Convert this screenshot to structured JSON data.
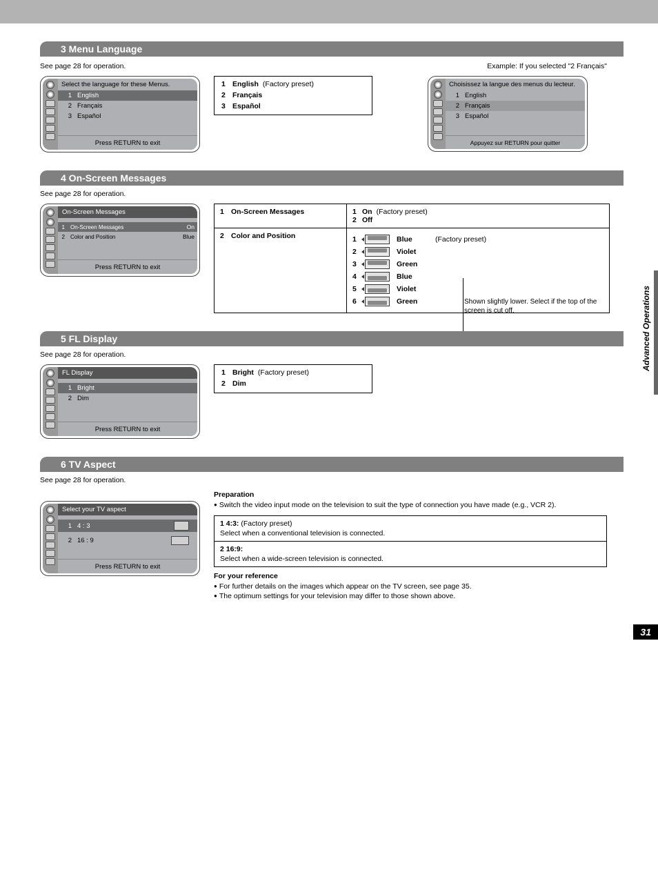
{
  "sideTab": "Advanced Operations",
  "pageNumber": "31",
  "section3": {
    "header": "3  Menu Language",
    "note": "See page 28 for operation.",
    "exampleLabel": "Example:  If you selected \"2 Français\"",
    "menu": {
      "title": "Select the language for these Menus.",
      "items": [
        {
          "num": "1",
          "label": "English"
        },
        {
          "num": "2",
          "label": "Français"
        },
        {
          "num": "3",
          "label": "Español"
        }
      ],
      "footer": "Press RETURN to exit"
    },
    "options": [
      {
        "num": "1",
        "label": "English",
        "note": " (Factory preset)"
      },
      {
        "num": "2",
        "label": "Français",
        "note": ""
      },
      {
        "num": "3",
        "label": "Español",
        "note": ""
      }
    ],
    "menuFr": {
      "title": "Choisissez la langue des menus du lecteur.",
      "items": [
        {
          "num": "1",
          "label": "English"
        },
        {
          "num": "2",
          "label": "Français"
        },
        {
          "num": "3",
          "label": "Español"
        }
      ],
      "footer": "Appuyez sur RETURN pour quitter"
    }
  },
  "section4": {
    "header": "4  On-Screen Messages",
    "note": "See page 28 for operation.",
    "menu": {
      "title": "On-Screen Messages",
      "items": [
        {
          "num": "1",
          "label": "On-Screen Messages",
          "val": "On"
        },
        {
          "num": "2",
          "label": "Color and Position",
          "val": "Blue"
        }
      ],
      "footer": "Press RETURN to exit"
    },
    "rows": {
      "r1Left": "On-Screen Messages",
      "r1Opts": [
        {
          "num": "1",
          "label": "On",
          "note": " (Factory preset)"
        },
        {
          "num": "2",
          "label": "Off",
          "note": ""
        }
      ],
      "r2Left": "Color and Position",
      "r2Opts": [
        {
          "num": "1",
          "label": "Blue",
          "note": " (Factory preset)"
        },
        {
          "num": "2",
          "label": "Violet"
        },
        {
          "num": "3",
          "label": "Green"
        },
        {
          "num": "4",
          "label": "Blue"
        },
        {
          "num": "5",
          "label": "Violet"
        },
        {
          "num": "6",
          "label": "Green"
        }
      ],
      "bracketNote": "Shown slightly lower. Select if the top of the screen is cut off."
    }
  },
  "section5": {
    "header": "5  FL Display",
    "note": "See page 28 for operation.",
    "menu": {
      "title": "FL Display",
      "items": [
        {
          "num": "1",
          "label": "Bright"
        },
        {
          "num": "2",
          "label": "Dim"
        }
      ],
      "footer": "Press RETURN to exit"
    },
    "options": [
      {
        "num": "1",
        "label": "Bright",
        "note": " (Factory preset)"
      },
      {
        "num": "2",
        "label": "Dim",
        "note": ""
      }
    ]
  },
  "section6": {
    "header": "6  TV Aspect",
    "note": "See page 28 for operation.",
    "menu": {
      "title": "Select your TV aspect",
      "items": [
        {
          "num": "1",
          "label": "4 : 3"
        },
        {
          "num": "2",
          "label": "16 : 9"
        }
      ],
      "footer": "Press RETURN to exit"
    },
    "prepHdr": "Preparation",
    "prepBody": "Switch the video input mode on the television to suit the type of connection you have made (e.g., VCR 2).",
    "opt1Head": "1   4:3:",
    "opt1Note": "  (Factory preset)",
    "opt1Body": "Select when a conventional television is connected.",
    "opt2Head": "2   16:9:",
    "opt2Body": "Select when a wide-screen television is connected.",
    "refHdr": "For your reference",
    "ref1": "For further details on the images which appear on the TV screen, see page 35.",
    "ref2": "The optimum settings for your television may differ to those shown above."
  }
}
